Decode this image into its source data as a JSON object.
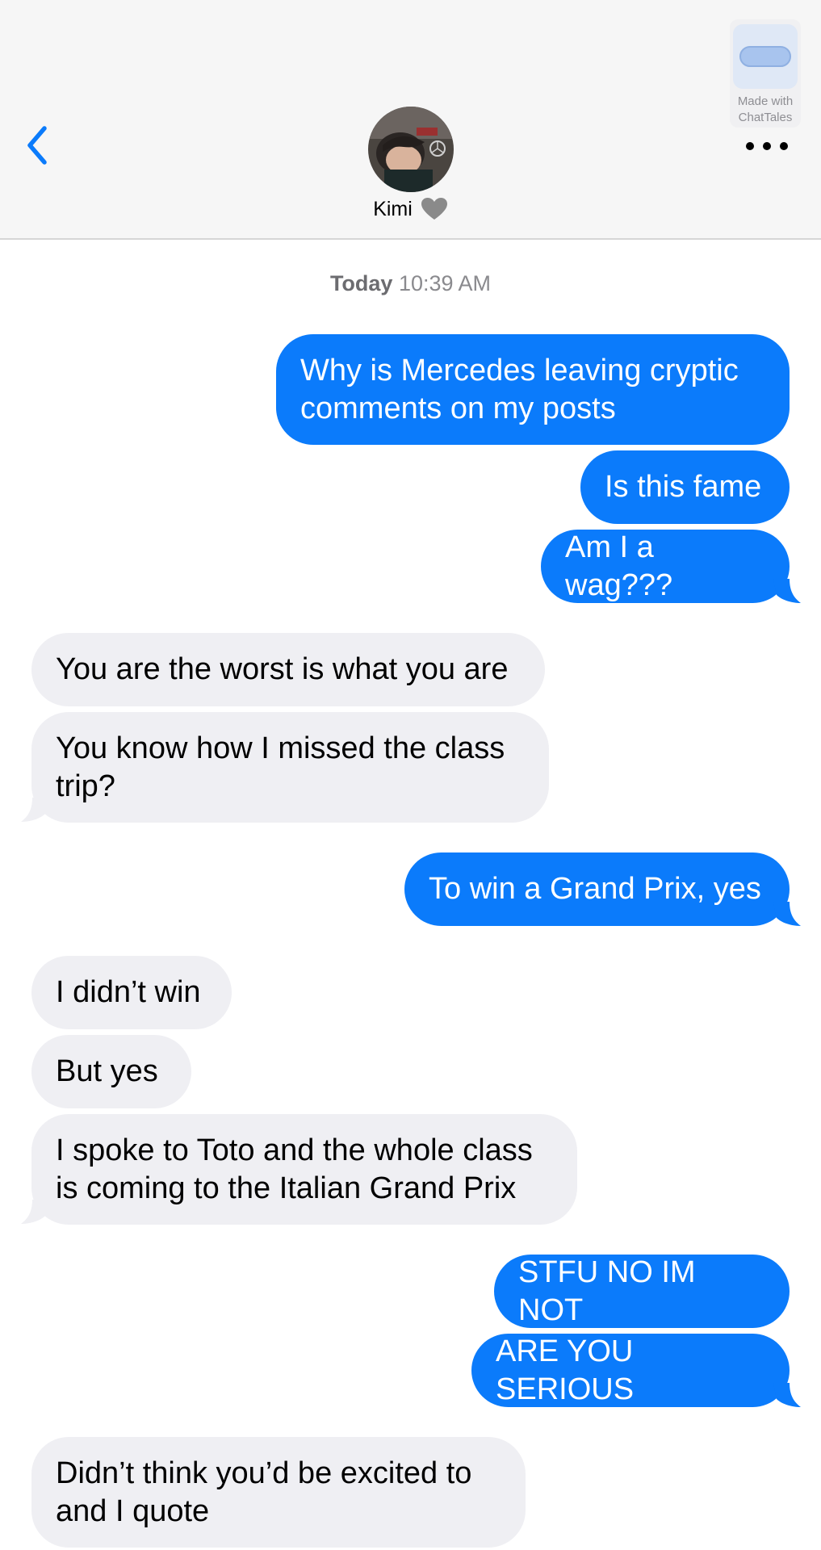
{
  "header": {
    "contact_name": "Kimi",
    "brand_line1": "Made with",
    "brand_line2": "ChatTales"
  },
  "timestamp": {
    "day": "Today",
    "time": "10:39 AM"
  },
  "messages": [
    {
      "direction": "sent",
      "text_lines": [
        "Why is Mercedes leaving cryptic",
        "comments on my posts"
      ]
    },
    {
      "direction": "sent",
      "text": "Is this fame"
    },
    {
      "direction": "sent",
      "text": "Am I a wag???"
    },
    {
      "direction": "received",
      "text": "You are the worst is what you are"
    },
    {
      "direction": "received",
      "text_lines": [
        "You know how I missed the class",
        "trip?"
      ]
    },
    {
      "direction": "sent",
      "text": "To win a Grand Prix, yes"
    },
    {
      "direction": "received",
      "text": "I didn’t win"
    },
    {
      "direction": "received",
      "text": "But yes"
    },
    {
      "direction": "received",
      "text_lines": [
        "I spoke to Toto and the whole class",
        "is coming to the Italian Grand Prix"
      ]
    },
    {
      "direction": "sent",
      "text": "STFU NO IM NOT"
    },
    {
      "direction": "sent",
      "text": "ARE YOU SERIOUS"
    },
    {
      "direction": "received",
      "text_lines": [
        "Didn’t think you’d be excited to",
        "and I quote"
      ]
    }
  ],
  "colors": {
    "sent_bubble": "#0b7bfb",
    "received_bubble": "#efeff3",
    "accent": "#0b7bfb"
  },
  "icons": [
    "chevron-left-icon",
    "heart-icon",
    "more-icon",
    "chat-bubble-icon"
  ]
}
